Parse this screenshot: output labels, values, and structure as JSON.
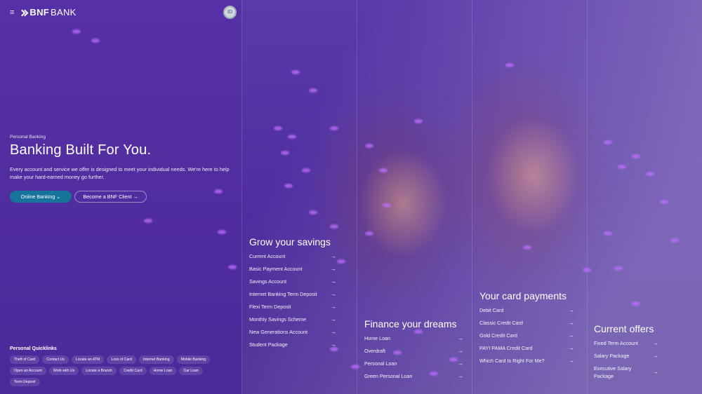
{
  "header": {
    "menu_icon": "≡",
    "logo_bold": "BNF",
    "logo_light": "BANK",
    "avatar_label": "ID"
  },
  "hero": {
    "eyebrow": "Personal Banking",
    "title": "Banking Built For You.",
    "description": "Every account and service we offer is designed to meet your individual needs. We're here to help make your hard-earned money go further.",
    "primary_button": "Online Banking ⌄",
    "secondary_button": "Become a BNF Client →"
  },
  "quicklinks": {
    "title": "Personal Quicklinks",
    "items": [
      "Theft of Card",
      "Contact Us",
      "Locate an ATM",
      "Loss of Card",
      "Internet Banking",
      "Mobile Banking",
      "Open an Account",
      "Work with Us",
      "Locate a Branch",
      "Credit Card",
      "Home Loan",
      "Car Loan",
      "Term Deposit"
    ]
  },
  "columns": [
    {
      "title": "Grow your savings",
      "items": [
        "Current Account",
        "Basic Payment Account",
        "Savings Account",
        "Internet Banking Term Deposit",
        "Flexi Term Deposit",
        "Monthly Savings Scheme",
        "New Generations Account",
        "Student Package"
      ]
    },
    {
      "title": "Finance your dreams",
      "items": [
        "Home Loan",
        "Overdraft",
        "Personal Loan",
        "Green Personal Loan"
      ]
    },
    {
      "title": "Your card payments",
      "items": [
        "Debit Card",
        "Classic Credit Card",
        "Gold Credit Card",
        "PAYI PAMA Credit Card",
        "Which Card Is Right For Me?"
      ]
    },
    {
      "title": "Current offers",
      "items": [
        "Fixed Term Account",
        "Salary Package",
        "Executive Salary Package"
      ]
    }
  ],
  "arrow_glyph": "→",
  "colors": {
    "primary_button": "#16739a",
    "overlay": "#4b2a9a"
  }
}
